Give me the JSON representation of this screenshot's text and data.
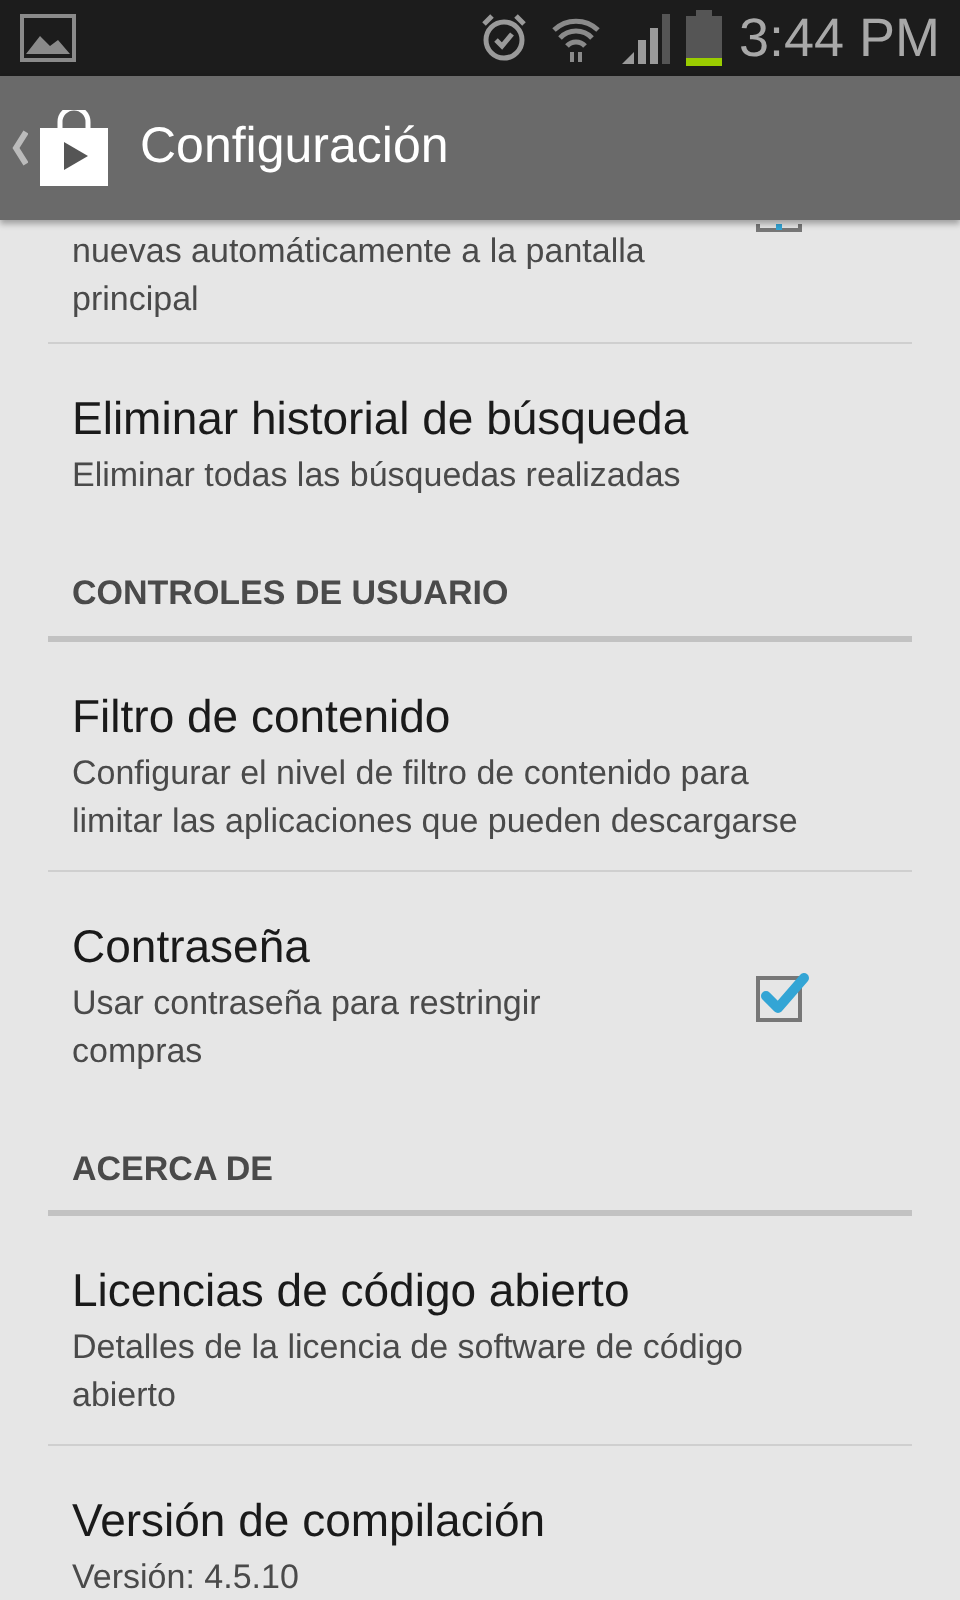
{
  "status_bar": {
    "time": "3:44 PM"
  },
  "action_bar": {
    "title": "Configuración"
  },
  "items": [
    {
      "kind": "pref",
      "summary": "nuevas automáticamente a la pantalla principal",
      "checked": true,
      "partial": true
    },
    {
      "kind": "pref",
      "title": "Eliminar historial de búsqueda",
      "summary": "Eliminar todas las búsquedas realizadas"
    },
    {
      "kind": "header",
      "title": "CONTROLES DE USUARIO"
    },
    {
      "kind": "pref",
      "title": "Filtro de contenido",
      "summary": "Configurar el nivel de filtro de contenido para limitar las aplicaciones que pueden descargarse"
    },
    {
      "kind": "pref",
      "title": "Contraseña",
      "summary": "Usar contraseña para restringir compras",
      "checked": true
    },
    {
      "kind": "header",
      "title": "ACERCA DE"
    },
    {
      "kind": "pref",
      "title": "Licencias de código abierto",
      "summary": "Detalles de la licencia de software de código abierto"
    },
    {
      "kind": "pref",
      "title": "Versión de compilación",
      "summary": "Versión: 4.5.10"
    }
  ]
}
